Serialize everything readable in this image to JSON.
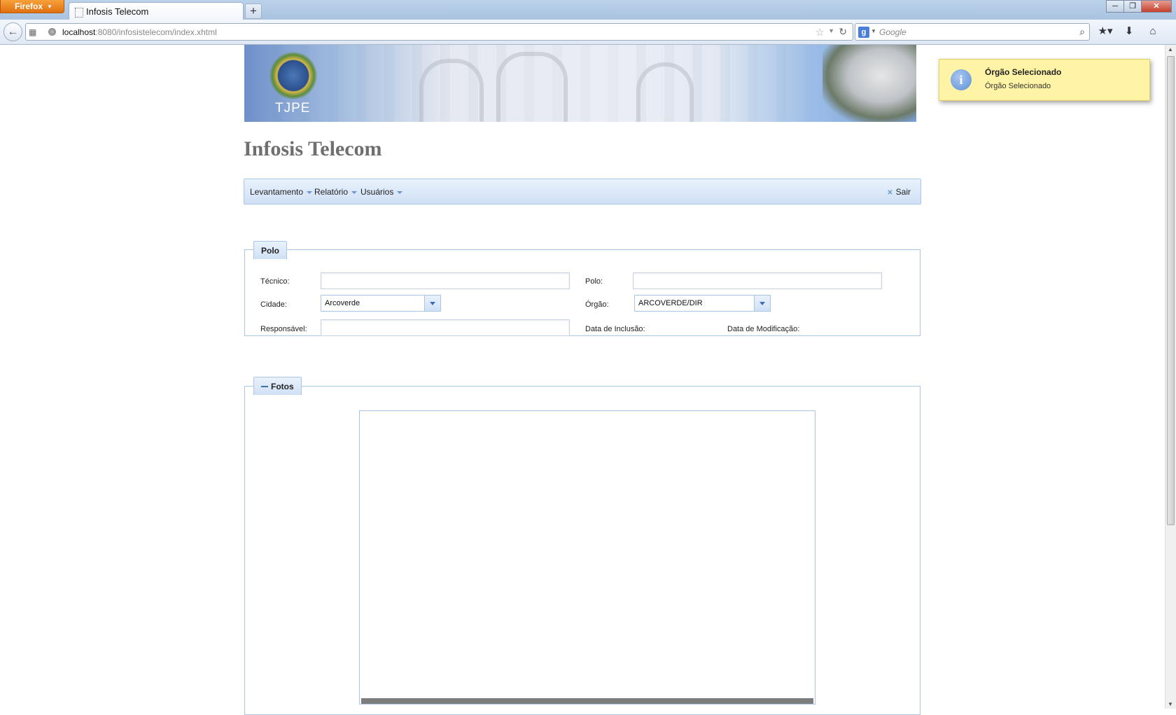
{
  "browser": {
    "app_button": "Firefox",
    "tab_title": "Infosis Telecom",
    "new_tab": "+",
    "url_host": "localhost",
    "url_rest": ":8080/infosistelecom/index.xhtml",
    "search_placeholder": "Google",
    "search_engine_letter": "g"
  },
  "banner": {
    "label": "TJPE"
  },
  "page": {
    "title": "Infosis Telecom"
  },
  "menu": {
    "items": [
      "Levantamento",
      "Relatório",
      "Usuários"
    ],
    "logout": "Sair"
  },
  "polo_panel": {
    "legend": "Polo",
    "tecnico_label": "Técnico:",
    "tecnico_value": "",
    "polo_label": "Polo:",
    "polo_value": "",
    "cidade_label": "Cidade:",
    "cidade_value": "Arcoverde",
    "orgao_label": "Órgão:",
    "orgao_value": "ARCOVERDE/DIR",
    "responsavel_label": "Responsável:",
    "responsavel_value": "",
    "data_inclusao_label": "Data de Inclusão:",
    "data_modificacao_label": "Data de Modificação:"
  },
  "fotos_panel": {
    "legend": "Fotos"
  },
  "notification": {
    "title": "Órgão Selecionado",
    "message": "Órgão Selecionado",
    "icon": "i"
  },
  "colors": {
    "accent": "#a9c6e8",
    "notification_bg": "#fff3a6",
    "title_gray": "#6f6f6f"
  }
}
